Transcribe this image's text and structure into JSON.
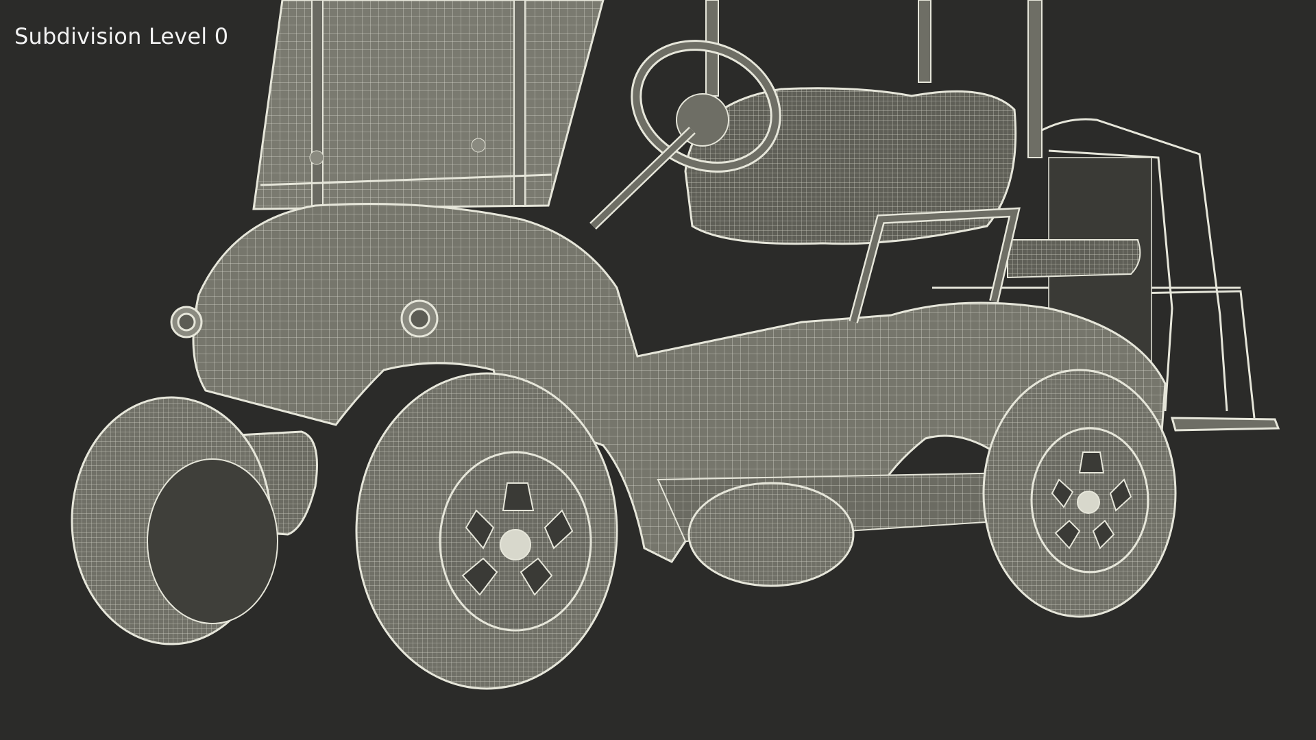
{
  "overlay": {
    "label": "Subdivision Level 0"
  },
  "scene": {
    "subject": "golf cart wireframe",
    "background_color": "#2b2b29",
    "mesh_fill": "#76766c",
    "mesh_fill_dark": "#5c5c54",
    "wire_color": "#e6e6da"
  }
}
